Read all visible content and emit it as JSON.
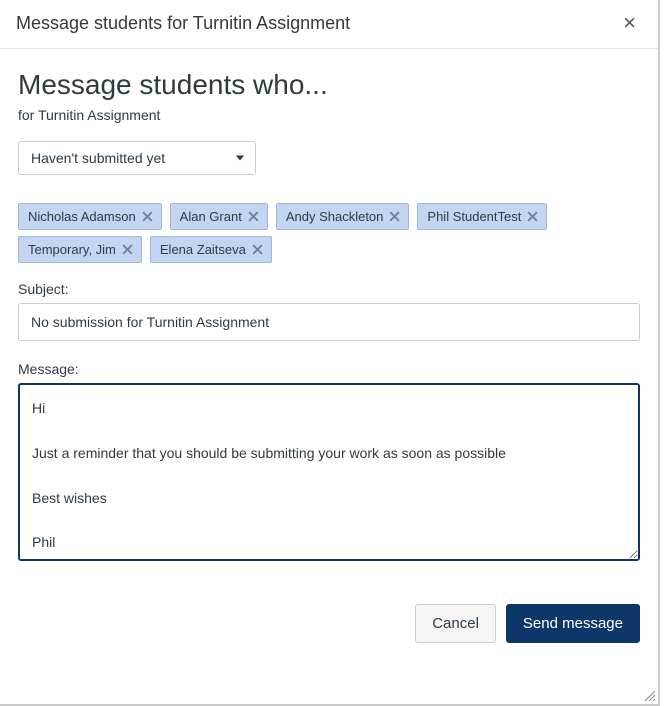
{
  "modal": {
    "title": "Message students for Turnitin Assignment",
    "close_label": "Close"
  },
  "page": {
    "title": "Message students who...",
    "subhead": "for Turnitin Assignment"
  },
  "filter": {
    "selected": "Haven't submitted yet"
  },
  "recipients": [
    {
      "name": "Nicholas Adamson"
    },
    {
      "name": "Alan Grant"
    },
    {
      "name": "Andy Shackleton"
    },
    {
      "name": "Phil StudentTest"
    },
    {
      "name": "Temporary, Jim"
    },
    {
      "name": "Elena Zaitseva"
    }
  ],
  "labels": {
    "subject": "Subject:",
    "message": "Message:"
  },
  "form": {
    "subject": "No submission for Turnitin Assignment",
    "message": "Hi\n\nJust a reminder that you should be submitting your work as soon as possible\n\nBest wishes\n\nPhil"
  },
  "footer": {
    "cancel": "Cancel",
    "send": "Send message"
  }
}
